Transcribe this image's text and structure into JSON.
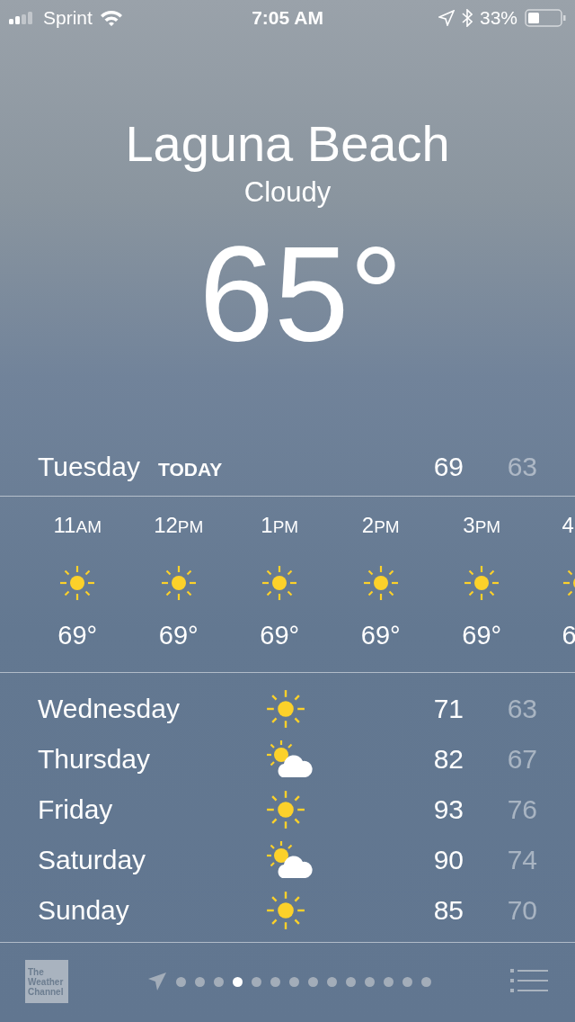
{
  "status_bar": {
    "carrier": "Sprint",
    "time": "7:05 AM",
    "battery": "33%"
  },
  "location": {
    "city": "Laguna Beach",
    "condition": "Cloudy",
    "temperature": "65°"
  },
  "today": {
    "day": "Tuesday",
    "label": "TODAY",
    "high": "69",
    "low": "63"
  },
  "hourly": [
    {
      "number": "11",
      "period": "AM",
      "kind": "sun",
      "temp": "69°"
    },
    {
      "number": "12",
      "period": "PM",
      "kind": "sun",
      "temp": "69°"
    },
    {
      "number": "1",
      "period": "PM",
      "kind": "sun",
      "temp": "69°"
    },
    {
      "number": "2",
      "period": "PM",
      "kind": "sun",
      "temp": "69°"
    },
    {
      "number": "3",
      "period": "PM",
      "kind": "sun",
      "temp": "69°"
    },
    {
      "number": "4",
      "kind": "sun",
      "temp": "6"
    }
  ],
  "daily": [
    {
      "day": "Wednesday",
      "kind": "sun",
      "high": "71",
      "low": "63"
    },
    {
      "day": "Thursday",
      "kind": "partly-cloudy",
      "high": "82",
      "low": "67"
    },
    {
      "day": "Friday",
      "kind": "sun",
      "high": "93",
      "low": "76"
    },
    {
      "day": "Saturday",
      "kind": "partly-cloudy",
      "high": "90",
      "low": "74"
    },
    {
      "day": "Sunday",
      "kind": "sun",
      "high": "85",
      "low": "70"
    }
  ],
  "footer": {
    "logo": [
      "The",
      "Weather",
      "Channel"
    ],
    "pages": [
      {
        "selected": false
      },
      {
        "selected": false
      },
      {
        "selected": false
      },
      {
        "selected": true
      },
      {
        "selected": false
      },
      {
        "selected": false
      },
      {
        "selected": false
      },
      {
        "selected": false
      },
      {
        "selected": false
      },
      {
        "selected": false
      },
      {
        "selected": false
      },
      {
        "selected": false
      },
      {
        "selected": false
      },
      {
        "selected": false
      }
    ]
  }
}
